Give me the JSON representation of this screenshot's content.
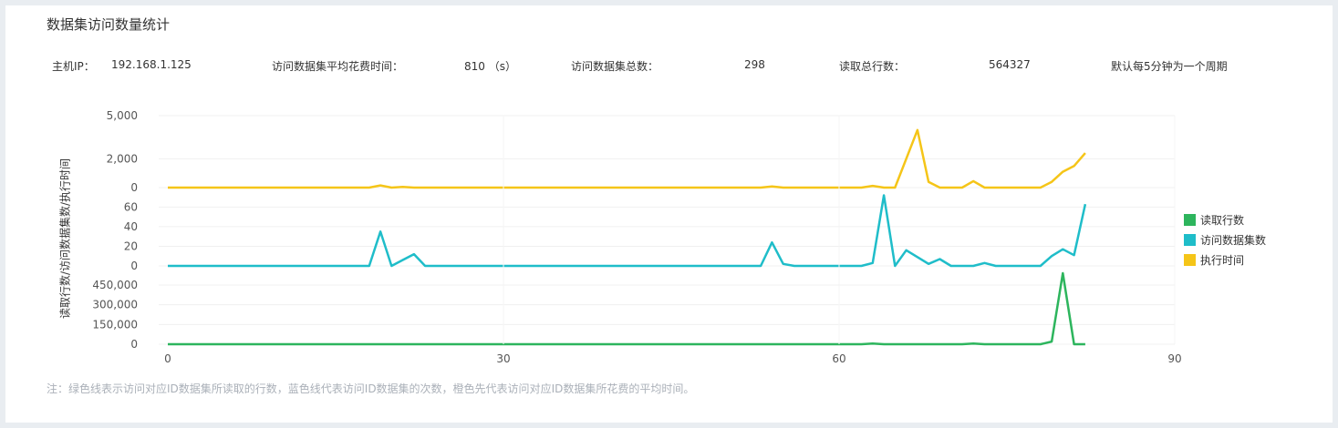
{
  "title": "数据集访问数量统计",
  "info": {
    "host_label": "主机IP：",
    "host_value": "192.168.1.125",
    "avg_time_label": "访问数据集平均花费时间：",
    "avg_time_value": "810 （s）",
    "total_datasets_label": "访问数据集总数：",
    "total_datasets_value": "298",
    "total_rows_label": "读取总行数：",
    "total_rows_value": "564327",
    "period_note": "默认每5分钟为一个周期"
  },
  "note": "注：绿色线表示访问对应ID数据集所读取的行数，蓝色线代表访问ID数据集的次数，橙色先代表访问对应ID数据集所花费的平均时间。",
  "colors": {
    "rows": "#2db55d",
    "visits": "#1fbdc9",
    "time": "#f5c518"
  },
  "chart_data": {
    "type": "line",
    "ylabel": "读取行数/访问数据集数/执行时间",
    "x_ticks": [
      0,
      30,
      60,
      90
    ],
    "xlim": [
      0,
      90
    ],
    "panels": [
      {
        "series": "执行时间",
        "y_ticks": [
          0,
          2000,
          5000
        ],
        "y_tick_labels": [
          "0",
          "2,000",
          "5,000"
        ],
        "ylim": [
          0,
          5000
        ],
        "points": [
          [
            0,
            0
          ],
          [
            18,
            0
          ],
          [
            19,
            150
          ],
          [
            20,
            0
          ],
          [
            21,
            50
          ],
          [
            22,
            0
          ],
          [
            53,
            0
          ],
          [
            54,
            80
          ],
          [
            55,
            0
          ],
          [
            62,
            0
          ],
          [
            63,
            120
          ],
          [
            64,
            0
          ],
          [
            65,
            0
          ],
          [
            66,
            2000
          ],
          [
            67,
            4000
          ],
          [
            68,
            400
          ],
          [
            69,
            0
          ],
          [
            71,
            0
          ],
          [
            72,
            450
          ],
          [
            73,
            0
          ],
          [
            78,
            0
          ],
          [
            79,
            400
          ],
          [
            80,
            1100
          ],
          [
            81,
            1500
          ],
          [
            82,
            2400
          ]
        ]
      },
      {
        "series": "访问数据集数",
        "y_ticks": [
          0,
          20,
          40,
          60
        ],
        "y_tick_labels": [
          "0",
          "20",
          "40",
          "60"
        ],
        "ylim": [
          0,
          65
        ],
        "points": [
          [
            0,
            0
          ],
          [
            18,
            0
          ],
          [
            19,
            35
          ],
          [
            20,
            0
          ],
          [
            21,
            6
          ],
          [
            22,
            12
          ],
          [
            23,
            0
          ],
          [
            53,
            0
          ],
          [
            54,
            24
          ],
          [
            55,
            2
          ],
          [
            56,
            0
          ],
          [
            62,
            0
          ],
          [
            63,
            3
          ],
          [
            64,
            72
          ],
          [
            65,
            0
          ],
          [
            66,
            16
          ],
          [
            67,
            9
          ],
          [
            68,
            2
          ],
          [
            69,
            7
          ],
          [
            70,
            0
          ],
          [
            72,
            0
          ],
          [
            73,
            3
          ],
          [
            74,
            0
          ],
          [
            78,
            0
          ],
          [
            79,
            10
          ],
          [
            80,
            17
          ],
          [
            81,
            11
          ],
          [
            82,
            63
          ]
        ]
      },
      {
        "series": "读取行数",
        "y_ticks": [
          0,
          150000,
          300000,
          450000
        ],
        "y_tick_labels": [
          "0",
          "150,000",
          "300,000",
          "450,000"
        ],
        "ylim": [
          0,
          450000
        ],
        "points": [
          [
            0,
            0
          ],
          [
            62,
            0
          ],
          [
            63,
            5000
          ],
          [
            64,
            0
          ],
          [
            71,
            0
          ],
          [
            72,
            5000
          ],
          [
            73,
            0
          ],
          [
            78,
            0
          ],
          [
            79,
            20000
          ],
          [
            80,
            540000
          ],
          [
            81,
            0
          ],
          [
            82,
            0
          ]
        ]
      }
    ],
    "legend": [
      "读取行数",
      "访问数据集数",
      "执行时间"
    ],
    "legend_position": "right"
  }
}
